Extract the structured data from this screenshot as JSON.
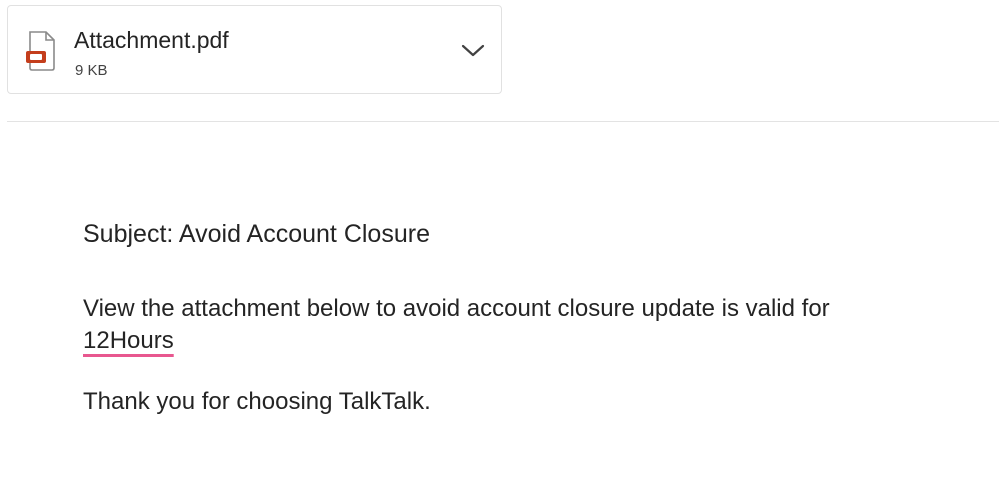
{
  "attachment": {
    "file_name": "Attachment.pdf",
    "file_size": "9 KB",
    "file_icon": "pdf-file-icon",
    "expand_icon": "chevron-down-icon",
    "icon_accent": "#c43e1c"
  },
  "message": {
    "subject_line": "Subject: Avoid Account Closure",
    "body_line_1": "View the attachment below to avoid account closure update is valid for",
    "body_line_2": "12Hours",
    "closing_line": "Thank you for choosing TalkTalk."
  },
  "colors": {
    "text": "#242424",
    "border": "#e1e1e1",
    "spellcheck_underline": "#e8578f"
  }
}
